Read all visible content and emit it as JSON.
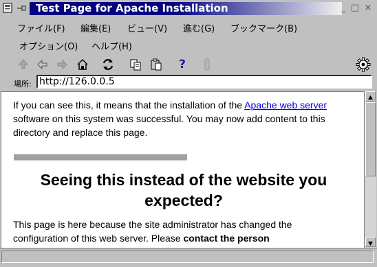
{
  "window": {
    "title": "Test Page for Apache Installation",
    "controls": [
      "_",
      "□",
      "×"
    ]
  },
  "menu": {
    "row1": [
      "ファイル(F)",
      "編集(E)",
      "ビュー(V)",
      "進む(G)",
      "ブックマーク(B)"
    ],
    "row2": [
      "オプション(O)",
      "ヘルプ(H)"
    ]
  },
  "toolbar": {
    "icons": [
      "up-arrow-icon",
      "back-arrow-icon",
      "forward-arrow-icon",
      "home-icon",
      "reload-icon",
      "copy-icon",
      "paste-icon",
      "help-icon",
      "stop-icon",
      "gear-icon"
    ],
    "help_glyph": "?"
  },
  "address": {
    "label": "場所:",
    "url": "http://126.0.0.5"
  },
  "page": {
    "p1_before": "If you can see this, it means that the installation of the ",
    "p1_link": "Apache web server",
    "p1_after": " software on this system was successful. You may now add content to this directory and replace this page.",
    "heading": "Seeing this instead of the website you expected?",
    "p2_before": "This page is here because the site administrator has changed the configuration of this web server. Please ",
    "p2_bold": "contact the person",
    "p2_after": ""
  },
  "colors": {
    "title_bg": "#000080",
    "link": "#0000ee",
    "chrome": "#c0c0c0"
  }
}
